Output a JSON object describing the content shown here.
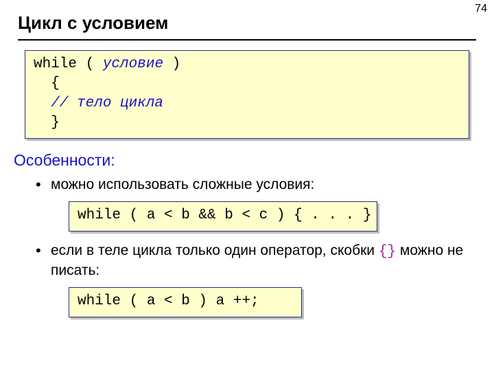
{
  "page_number": "74",
  "title": "Цикл с условием",
  "code1": {
    "line1_a": "while ( ",
    "line1_b_cond": "условие",
    "line1_c": " )",
    "line2": "{",
    "line3_a": "// ",
    "line3_b_body": "тело цикла",
    "line4": "}"
  },
  "section_heading": "Особенности:",
  "bullet1": "можно использовать сложные условия:",
  "code2": "while ( a < b && b < c ) { . . . }",
  "bullet2_a": "если в теле цикла только один оператор, скобки ",
  "bullet2_brackets": "{}",
  "bullet2_b": " можно не писать:",
  "code3": "while ( a < b ) a ++;"
}
